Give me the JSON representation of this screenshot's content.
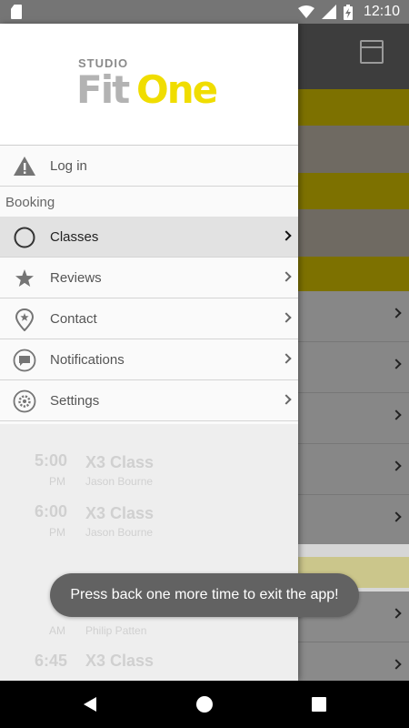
{
  "status_bar": {
    "time": "12:10",
    "icons": [
      "sd-card-icon",
      "wifi-icon",
      "signal-icon",
      "battery-charging-icon"
    ]
  },
  "drawer": {
    "logo": {
      "studio": "STUDIO",
      "fit": "Fit",
      "one": "One"
    },
    "login": {
      "label": "Log in",
      "icon": "warning-icon"
    },
    "section_header": "Booking",
    "items": [
      {
        "label": "Classes",
        "icon": "circle-icon",
        "active": true
      },
      {
        "label": "Reviews",
        "icon": "star-icon",
        "active": false
      },
      {
        "label": "Contact",
        "icon": "location-pin-icon",
        "active": false
      },
      {
        "label": "Notifications",
        "icon": "chat-bubble-icon",
        "active": false
      },
      {
        "label": "Settings",
        "icon": "gear-icon",
        "active": false
      }
    ]
  },
  "background": {
    "rows": [
      {
        "time": "5:00",
        "ampm": "PM",
        "class": "X3 Class",
        "instructor": "Jason Bourne"
      },
      {
        "time": "6:00",
        "ampm": "PM",
        "class": "X3 Class",
        "instructor": "Jason Bourne"
      },
      {
        "time": "6:45",
        "ampm": "AM",
        "class": "X3 Class",
        "instructor": "Philip Patten"
      }
    ]
  },
  "toast": {
    "message": "Press back one more time to exit the app!"
  },
  "colors": {
    "accent": "#f0dd00",
    "drawer_bg": "#fafafa",
    "toast_bg": "#626262"
  }
}
